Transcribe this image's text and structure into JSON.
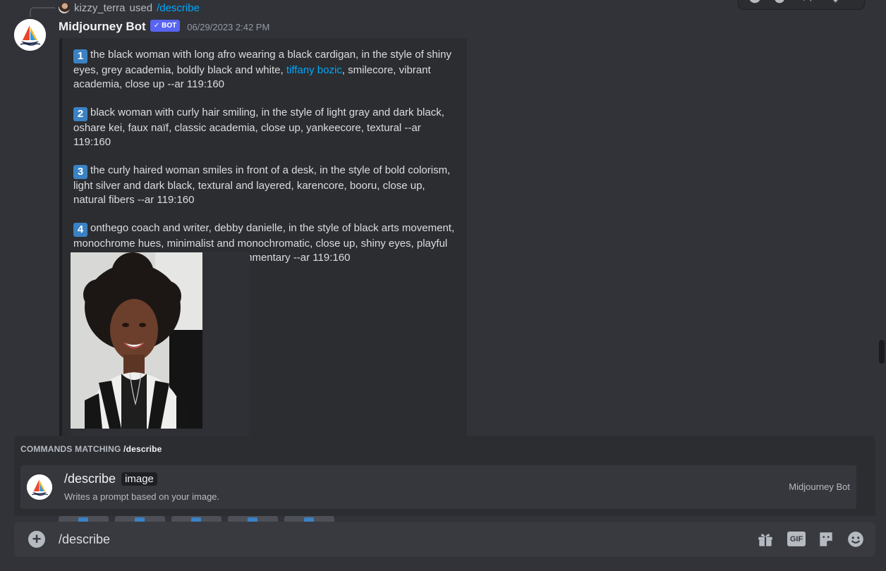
{
  "reply": {
    "user": "kizzy_terra",
    "used_text": "used",
    "command": "/describe"
  },
  "message": {
    "author": "Midjourney Bot",
    "bot_tag": "BOT",
    "timestamp": "06/29/2023 2:42 PM",
    "prompts": [
      {
        "number": "1",
        "text_before_link": "the black woman with long afro wearing a black cardigan, in the style of shiny eyes, grey academia, boldly black and white, ",
        "link": "tiffany bozic",
        "text_after_link": ", smilecore, vibrant academia, close up --ar 119:160"
      },
      {
        "number": "2",
        "text": "black woman with curly hair smiling, in the style of light gray and dark black, oshare kei, faux naïf, classic academia, close up, yankeecore, textural --ar 119:160"
      },
      {
        "number": "3",
        "text": "the curly haired woman smiles in front of a desk, in the style of bold colorism, light silver and dark black, textural and layered, karencore, booru, close up, natural fibers --ar 119:160"
      },
      {
        "number": "4",
        "text": "onthego coach and writer, debby danielle, in the style of black arts movement, monochrome hues, minimalist and monochromatic, close up, shiny eyes, playful use of texture, social and political commentary --ar 119:160"
      }
    ]
  },
  "command_popup": {
    "heading_prefix": "COMMANDS MATCHING",
    "heading_query": "/describe",
    "option": {
      "command": "/describe",
      "param": "image",
      "description": "Writes a prompt based on your image.",
      "source": "Midjourney Bot"
    }
  },
  "chat_input": {
    "value": "/describe"
  },
  "colors": {
    "background": "#313338",
    "embed": "#2b2d31",
    "link": "#00a8fc",
    "bot_tag": "#5865f2",
    "number_badge": "#3b82c4"
  },
  "icons": [
    "add-attachment-icon",
    "gift-icon",
    "gif-icon",
    "sticker-icon",
    "emoji-icon",
    "reaction-icon",
    "reply-icon",
    "more-icon"
  ]
}
